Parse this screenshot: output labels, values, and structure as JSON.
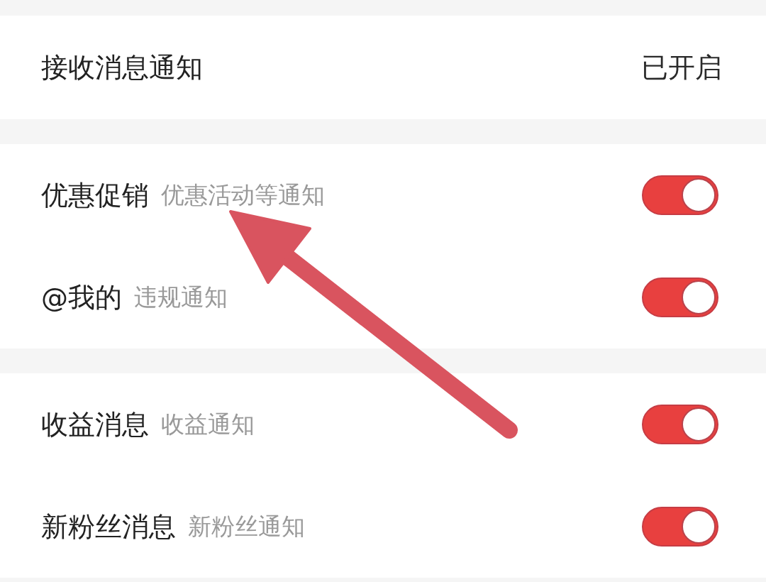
{
  "sections": [
    {
      "rows": [
        {
          "kind": "status",
          "label": "接收消息通知",
          "value": "已开启"
        }
      ]
    },
    {
      "rows": [
        {
          "kind": "toggle",
          "label": "优惠促销",
          "description": "优惠活动等通知",
          "on": true
        },
        {
          "kind": "toggle",
          "label": "@我的",
          "description": "违规通知",
          "on": true
        }
      ]
    },
    {
      "rows": [
        {
          "kind": "toggle",
          "label": "收益消息",
          "description": "收益通知",
          "on": true
        },
        {
          "kind": "toggle",
          "label": "新粉丝消息",
          "description": "新粉丝通知",
          "on": true
        }
      ]
    }
  ]
}
